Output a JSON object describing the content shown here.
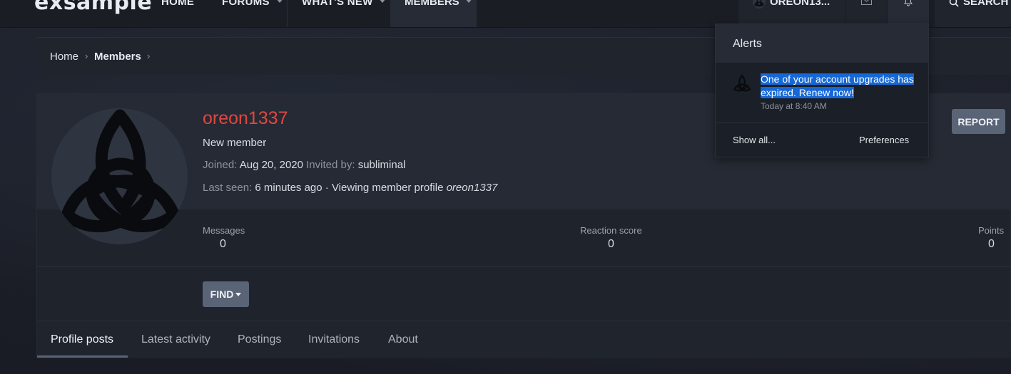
{
  "header": {
    "logo": "exsample",
    "nav": {
      "home": "HOME",
      "forums": "FORUMS",
      "whats_new": "WHAT'S NEW",
      "members": "MEMBERS"
    },
    "user_label": "OREON13...",
    "search_label": "SEARCH"
  },
  "breadcrumb": {
    "home": "Home",
    "members": "Members"
  },
  "profile": {
    "username": "oreon1337",
    "user_title": "New member",
    "joined_label": "Joined:",
    "joined_value": "Aug 20, 2020",
    "invited_label": "Invited by:",
    "invited_value": "subliminal",
    "last_seen_label": "Last seen:",
    "last_seen_value": "6 minutes ago · Viewing member profile",
    "last_seen_target": "oreon1337",
    "report_label": "REPORT",
    "find_label": "FIND",
    "stats": [
      {
        "label": "Messages",
        "value": "0"
      },
      {
        "label": "Reaction score",
        "value": "0"
      },
      {
        "label": "Points",
        "value": "0"
      }
    ],
    "tabs": [
      "Profile posts",
      "Latest activity",
      "Postings",
      "Invitations",
      "About"
    ]
  },
  "alerts": {
    "title": "Alerts",
    "items": [
      {
        "text": "One of your account upgrades has expired. Renew now!",
        "time": "Today at 8:40 AM"
      }
    ],
    "show_all": "Show all...",
    "preferences": "Preferences"
  },
  "colors": {
    "username": "#e0473f",
    "button": "#5a6477",
    "highlight": "#1668d6"
  }
}
